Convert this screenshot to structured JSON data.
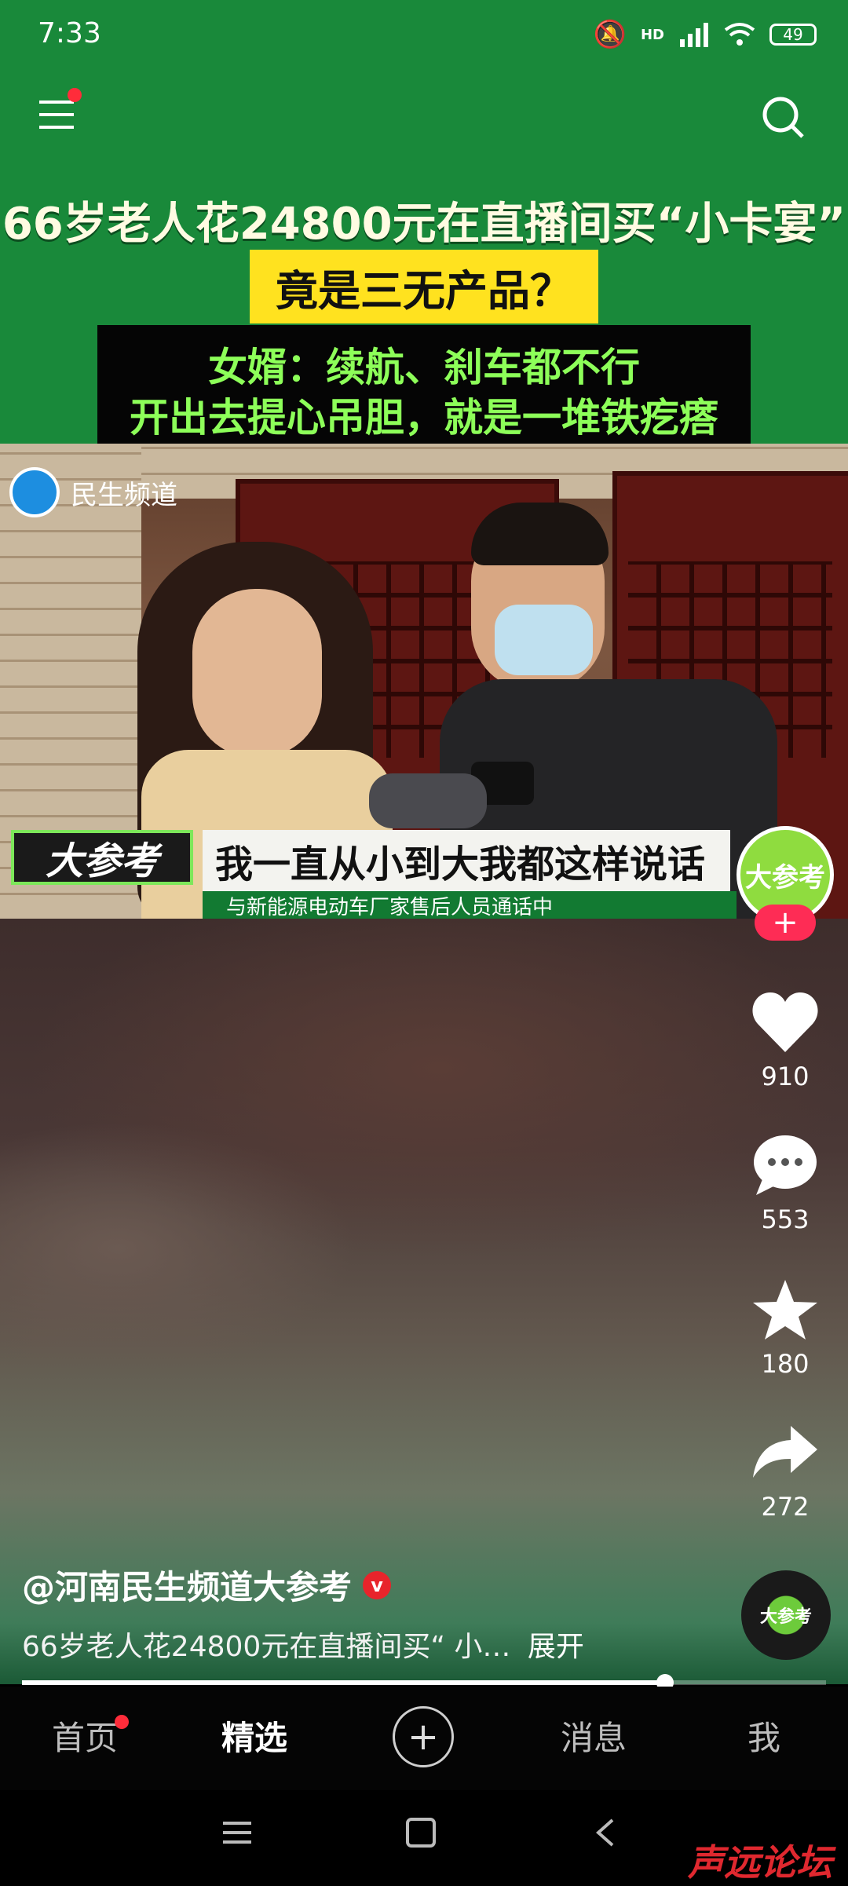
{
  "status_bar": {
    "time": "7:33",
    "network": "HD",
    "battery": "49"
  },
  "headline": {
    "line1": "66岁老人花24800元在直播间买“小卡宴”",
    "line2": "竟是三无产品？",
    "line3": "女婿：续航、刹车都不行",
    "line4": "开出去提心吊胆，就是一堆铁疙瘩"
  },
  "video": {
    "channel_logo": "民生频道",
    "tag": "大参考",
    "subtitle": "我一直从小到大我都这样说话",
    "subcaption": "与新能源电动车厂家售后人员通话中"
  },
  "side_actions": {
    "avatar_text": "大参考",
    "follow": "+",
    "like_count": "910",
    "comment_count": "553",
    "favorite_count": "180",
    "share_count": "272",
    "music_disc_text": "大参考"
  },
  "post": {
    "author": "@河南民生频道大参考",
    "verified": "v",
    "caption": "66岁老人花24800元在直播间买“ 小…",
    "expand": "展开",
    "progress": 0.8
  },
  "nav": {
    "home": "首页",
    "featured": "精选",
    "plus": "+",
    "messages": "消息",
    "me": "我"
  },
  "watermark": "声远论坛",
  "colors": {
    "header_green": "#19893a",
    "accent_red": "#fe2c55",
    "headline_yellow": "#ffe21f",
    "headline_green_text": "#8dff59"
  }
}
